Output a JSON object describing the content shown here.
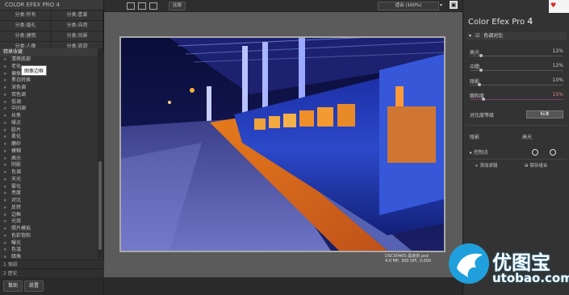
{
  "app": {
    "title": "COLOR EFEX PRO 4"
  },
  "categories": [
    "分类:所有",
    "分类:喜爱",
    "分类:婚礼",
    "分类:自然",
    "分类:建筑",
    "分类:风景",
    "分类:人像",
    "分类:旅游"
  ],
  "filter_header": "精華收藏",
  "tooltip": "图像边框",
  "filters": [
    "精華收藏",
    "清爽底部",
    "老化",
    "偏振镜效果",
    "黑白转换",
    "深色调",
    "双色调",
    "低调",
    "中间调",
    "长焦",
    "噪点",
    "胶片",
    "柔化",
    "磨砂",
    "模糊",
    "高光",
    "阴影",
    "色调",
    "天光",
    "雾化",
    "亮度",
    "对比",
    "反转",
    "边框",
    "光效",
    "照片模拟",
    "色彩饱和",
    "曝光",
    "色温",
    "暗角"
  ],
  "sections": {
    "presets": "1 預設",
    "history": "2 歷史"
  },
  "bottom_buttons": {
    "help": "幫助",
    "settings": "設置"
  },
  "toolbar": {
    "view_btn": "比较",
    "zoom": "适合 (100%)"
  },
  "caption": {
    "line1": "DSC00465-黑夜拼.psd",
    "line2": "4.0 MP, 300 DPI, 0,000"
  },
  "right": {
    "title_prefix": "Color Efex Pro",
    "title_version": "4",
    "header": "色调对比",
    "sliders": [
      {
        "label": "高光",
        "value": "12%",
        "fraction": 0.12
      },
      {
        "label": "中間",
        "value": "12%",
        "fraction": 0.12
      },
      {
        "label": "陰影",
        "value": "10%",
        "fraction": 0.1
      },
      {
        "label": "飽和度",
        "value": "15%",
        "fraction": 0.15
      }
    ],
    "contrast_type_label": "对比度等级",
    "contrast_type_value": "标准",
    "shadows_label": "陰影",
    "highlights_label": "高光",
    "control_points": "控制点",
    "add_filter": "添加滤镜",
    "favorite": "保存组合"
  },
  "watermark": {
    "title": "优图宝",
    "url": "utobao.com"
  }
}
